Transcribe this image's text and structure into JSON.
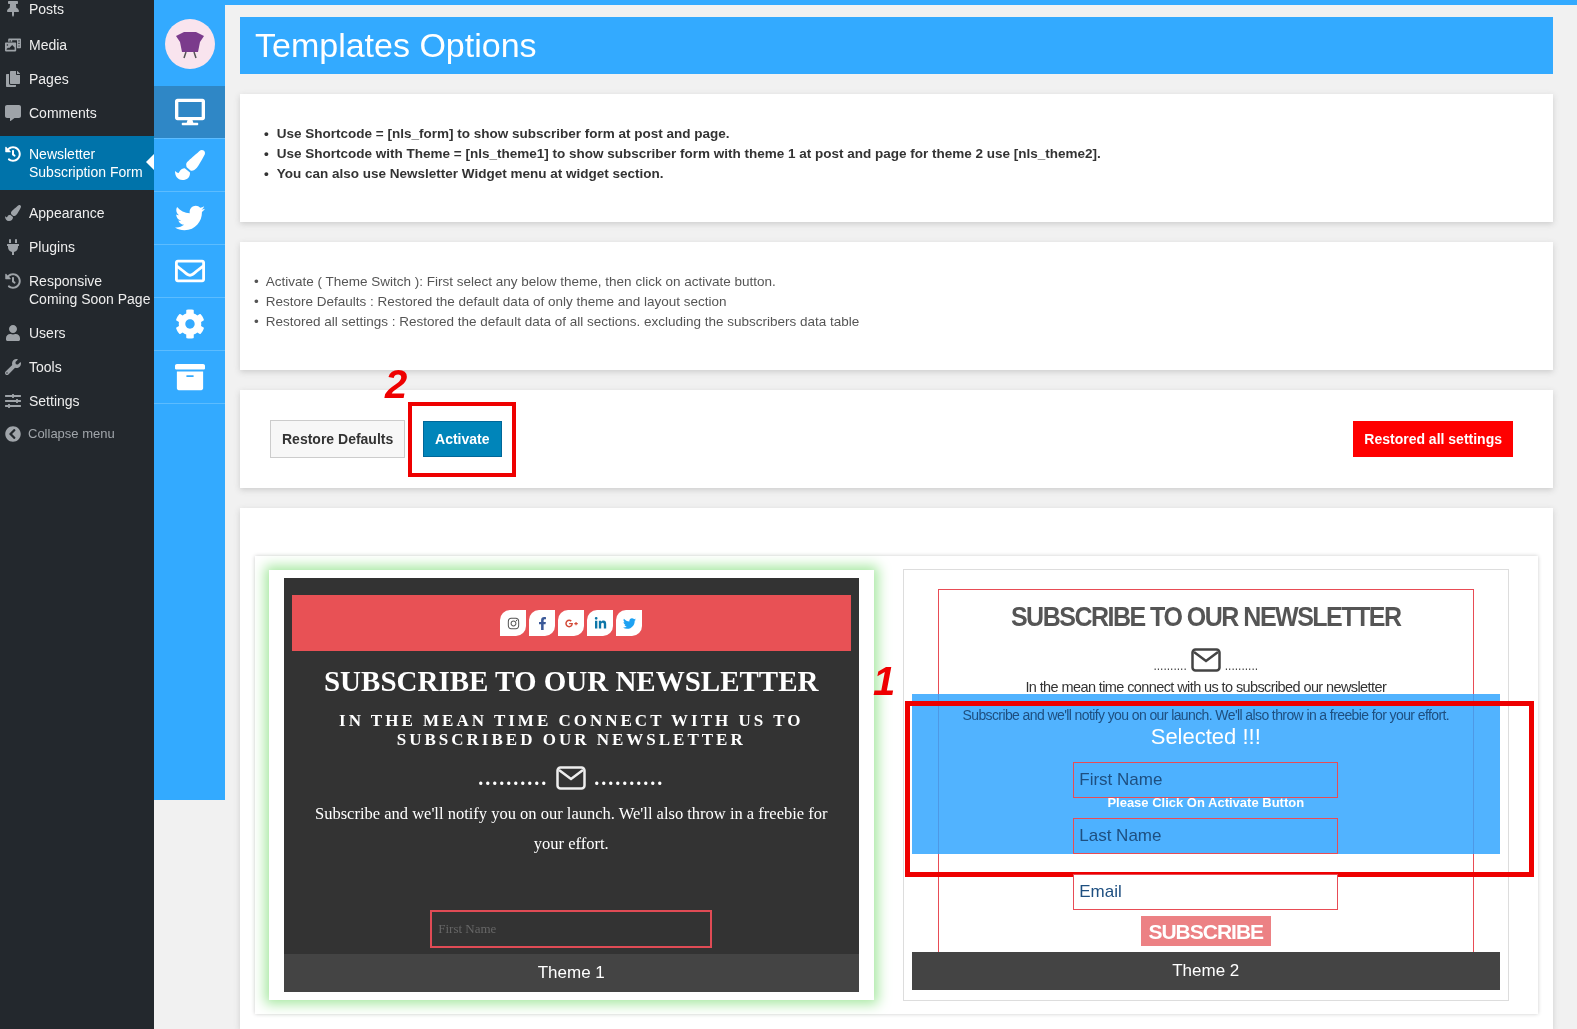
{
  "sidebar": {
    "items": [
      {
        "label": "Posts",
        "selected": false
      },
      {
        "label": "Media",
        "selected": false
      },
      {
        "label": "Pages",
        "selected": false
      },
      {
        "label": "Comments",
        "selected": false
      },
      {
        "label": "Newsletter Subscription Form",
        "selected": true
      },
      {
        "label": "Appearance",
        "selected": false
      },
      {
        "label": "Plugins",
        "selected": false
      },
      {
        "label": "Responsive Coming Soon Page",
        "selected": false
      },
      {
        "label": "Users",
        "selected": false
      },
      {
        "label": "Tools",
        "selected": false
      },
      {
        "label": "Settings",
        "selected": false
      }
    ],
    "collapse_label": "Collapse menu"
  },
  "icon_rail": {
    "items": [
      {
        "selected": true
      },
      {
        "selected": false
      },
      {
        "selected": false
      },
      {
        "selected": false
      },
      {
        "selected": false
      },
      {
        "selected": false
      }
    ]
  },
  "page_title": "Templates Options",
  "bullet": "•",
  "shortcode_notes": [
    "Use Shortcode = [nls_form] to show subscriber form at post and page.",
    "Use Shortcode with Theme = [nls_theme1] to show subscriber form with theme 1 at post and page for theme 2 use [nls_theme2].",
    "You can also use Newsletter Widget menu at widget section."
  ],
  "help_notes": [
    "Activate ( Theme Switch ): First select any below theme, then click on activate button.",
    "Restore Defaults : Restored the default data of only theme and layout section",
    "Restored all settings : Restored the default data of all sections. excluding the subscribers data table"
  ],
  "actions": {
    "restore_defaults": "Restore Defaults",
    "activate": "Activate",
    "restore_all": "Restored all settings"
  },
  "annotations": [
    {
      "label": "2"
    },
    {
      "label": "1"
    }
  ],
  "themes": [
    {
      "kind": "dark",
      "caption": "Theme 1",
      "selected": false,
      "highlighted": true,
      "title": "SUBSCRIBE TO OUR NEWSLETTER",
      "subtitle": "IN THE MEAN TIME CONNECT WITH US TO SUBSCRIBED OUR NEWSLETTER",
      "dots_left": "..........",
      "dots_right": "..........",
      "body": "Subscribe and we'll notify you on our launch. We'll also throw in a freebie for your effort.",
      "fields": [
        {
          "placeholder": "First Name"
        }
      ]
    },
    {
      "kind": "light",
      "caption": "Theme 2",
      "selected": true,
      "highlighted": false,
      "title": "SUBSCRIBE TO OUR NEWSLETTER",
      "subtitle": "In the mean time connect with us to subscribed our newsletter",
      "dots_left": "..........",
      "dots_right": "..........",
      "body": "Subscribe and we'll notify you on our launch. We'll also throw in a freebie for your effort.",
      "fields": [
        {
          "placeholder": "First Name"
        },
        {
          "placeholder": "Last Name"
        },
        {
          "placeholder": "Email"
        }
      ],
      "button": "SUBSCRIBE"
    }
  ],
  "selection_overlay": {
    "title": "Selected !!!",
    "hint": "Please Click On Activate Button"
  }
}
